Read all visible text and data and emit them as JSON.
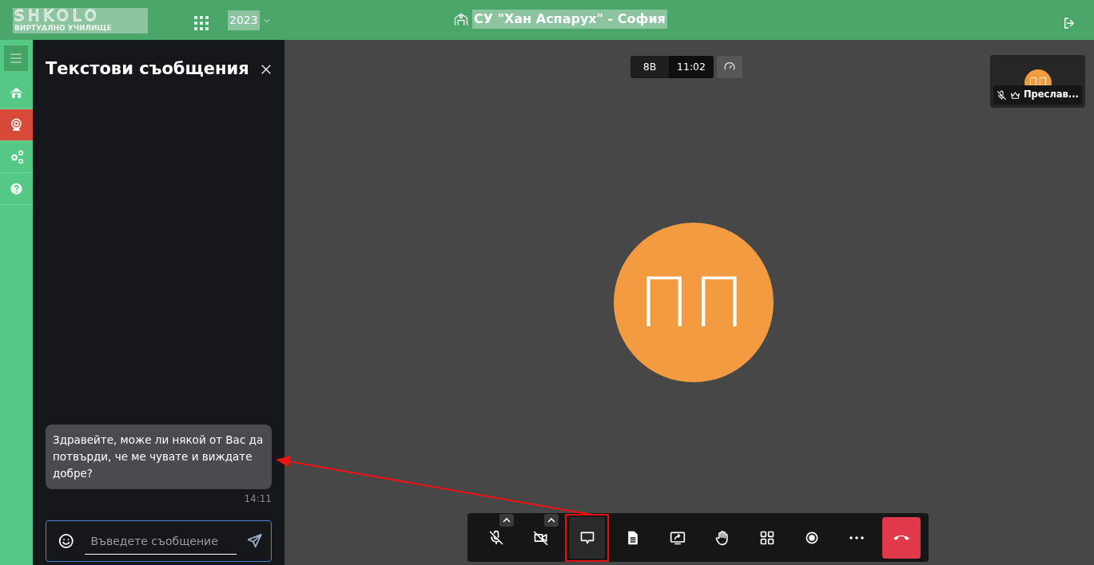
{
  "header": {
    "logo_title": "SHKOLO",
    "logo_subtitle": "ВИРТУАЛНО УЧИЛИЩЕ",
    "year": "2023",
    "school": "СУ \"Хан Аспарух\" - София"
  },
  "sidebar": {
    "items": [
      {
        "kind": "home",
        "selected": false
      },
      {
        "kind": "webcam",
        "selected": true
      },
      {
        "kind": "settings",
        "selected": false
      },
      {
        "kind": "help",
        "selected": false
      }
    ]
  },
  "chat": {
    "title": "Текстови съобщения",
    "messages": [
      {
        "text": "Здравейте, може ли някой от Вас да потвърди, че ме чувате и виждате добре?",
        "time": "14:11"
      }
    ],
    "input": {
      "placeholder": "Въведете съобщение"
    }
  },
  "meeting": {
    "class_label": "8В",
    "clock": "11:02",
    "speaker": {
      "initials": "ПП",
      "color": "#f29b40"
    },
    "thumbnail": {
      "initials": "ПП",
      "name": "Преслав...",
      "muted": true,
      "host": true,
      "color": "#f29b40"
    }
  },
  "toolbar": {
    "buttons": [
      {
        "kind": "mic-off",
        "selected": false,
        "has_menu": true
      },
      {
        "kind": "camera-off",
        "selected": false,
        "has_menu": true
      },
      {
        "kind": "chat",
        "selected": true,
        "has_menu": false
      },
      {
        "kind": "document",
        "selected": false,
        "has_menu": false
      },
      {
        "kind": "share-screen",
        "selected": false,
        "has_menu": false
      },
      {
        "kind": "raise-hand",
        "selected": false,
        "has_menu": false
      },
      {
        "kind": "grid",
        "selected": false,
        "has_menu": false
      },
      {
        "kind": "record",
        "selected": false,
        "has_menu": false
      },
      {
        "kind": "more",
        "selected": false,
        "has_menu": false
      },
      {
        "kind": "hang-up",
        "selected": false,
        "has_menu": false
      }
    ]
  }
}
